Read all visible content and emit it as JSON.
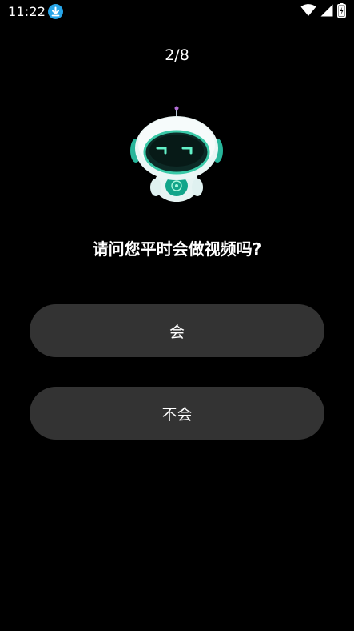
{
  "status_bar": {
    "time": "11:22",
    "icons": [
      "download-icon",
      "wifi-icon",
      "signal-icon",
      "battery-charging-icon"
    ],
    "accent_color": "#27a5e8"
  },
  "survey": {
    "progress": "2/8",
    "question": "请问您平时会做视频吗?",
    "options": [
      {
        "label": "会"
      },
      {
        "label": "不会"
      }
    ]
  },
  "theme": {
    "background": "#000000",
    "button_background": "#333333",
    "text_color": "#ffffff",
    "robot_accent": "#2fd0a5"
  }
}
